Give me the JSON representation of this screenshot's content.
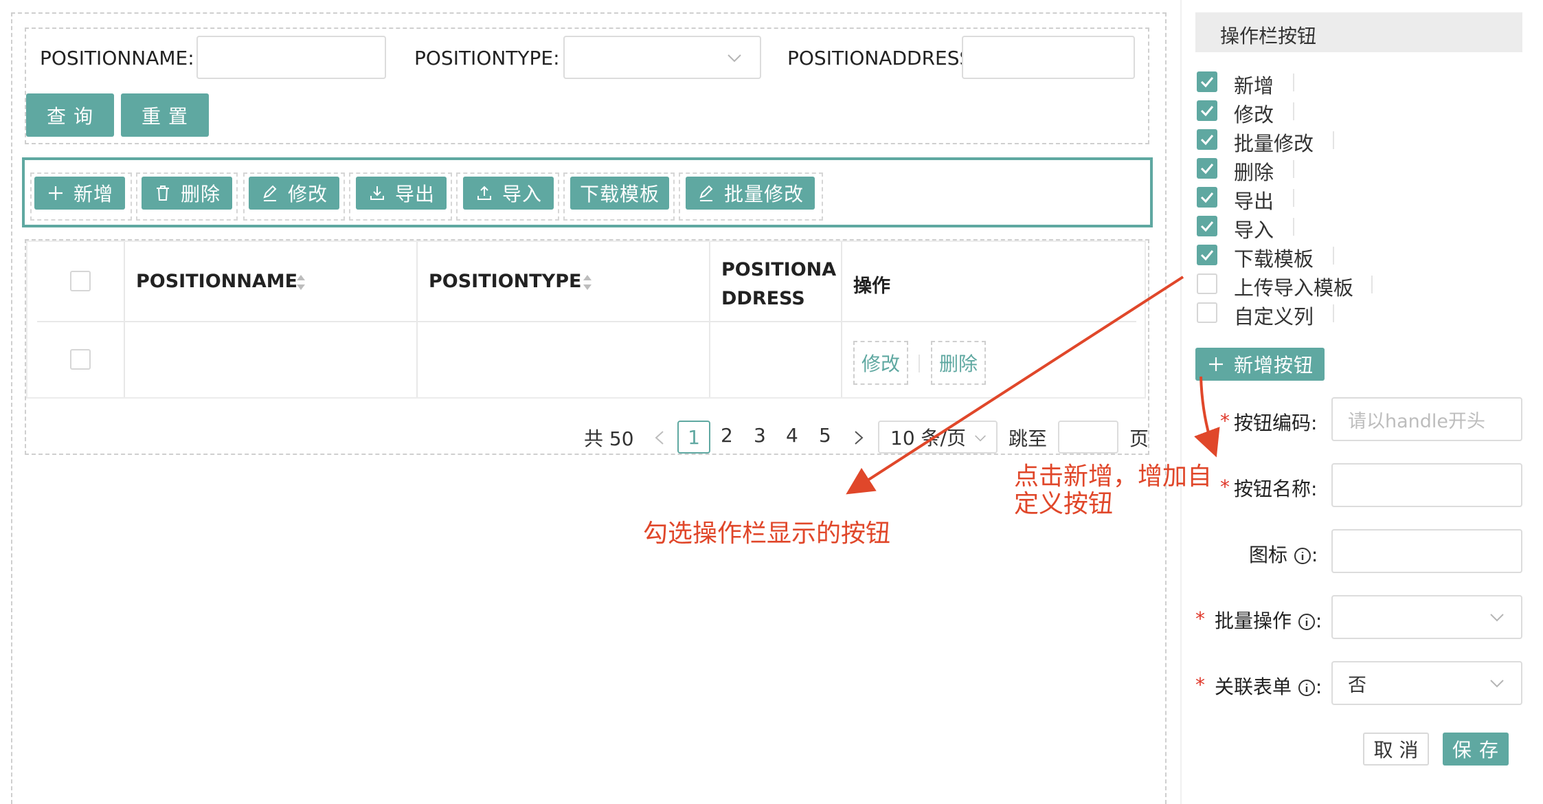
{
  "search": {
    "name_label": "POSITIONNAME:",
    "type_label": "POSITIONTYPE:",
    "address_label": "POSITIONADDRESS:",
    "query_button": "查 询",
    "reset_button": "重 置"
  },
  "toolbar": {
    "add": "新增",
    "delete": "删除",
    "edit": "修改",
    "export": "导出",
    "import": "导入",
    "download_template": "下载模板",
    "batch_edit": "批量修改"
  },
  "table": {
    "col_name": "POSITIONNAME",
    "col_type": "POSITIONTYPE",
    "col_address_line1": "POSITIONA",
    "col_address_line2": "DDRESS",
    "col_action": "操作",
    "row_edit": "修改",
    "row_delete": "删除"
  },
  "pagination": {
    "total": "共 50",
    "pages": [
      "1",
      "2",
      "3",
      "4",
      "5"
    ],
    "current_page": "1",
    "page_size": "10 条/页",
    "jump_label": "跳至",
    "page_suffix": "页"
  },
  "panel": {
    "title": "操作栏按钮",
    "options": [
      {
        "label": "新增",
        "checked": true
      },
      {
        "label": "修改",
        "checked": true
      },
      {
        "label": "批量修改",
        "checked": true
      },
      {
        "label": "删除",
        "checked": true
      },
      {
        "label": "导出",
        "checked": true
      },
      {
        "label": "导入",
        "checked": true
      },
      {
        "label": "下载模板",
        "checked": true
      },
      {
        "label": "上传导入模板",
        "checked": false
      },
      {
        "label": "自定义列",
        "checked": false
      }
    ],
    "add_button": "新增按钮",
    "form": {
      "code_label": "按钮编码:",
      "code_placeholder": "请以handle开头",
      "name_label": "按钮名称:",
      "icon_label": "图标",
      "batch_label": "批量操作",
      "related_label": "关联表单",
      "related_value": "否",
      "colon": ":"
    },
    "cancel_button": "取 消",
    "save_button": "保 存"
  },
  "annotations": {
    "checkbox_note": "勾选操作栏显示的按钮",
    "add_note_line1": "点击新增，增加自",
    "add_note_line2": "定义按钮"
  },
  "colors": {
    "accent": "#5fa8a1",
    "annotation": "#e0472a",
    "required": "#e0392b"
  }
}
